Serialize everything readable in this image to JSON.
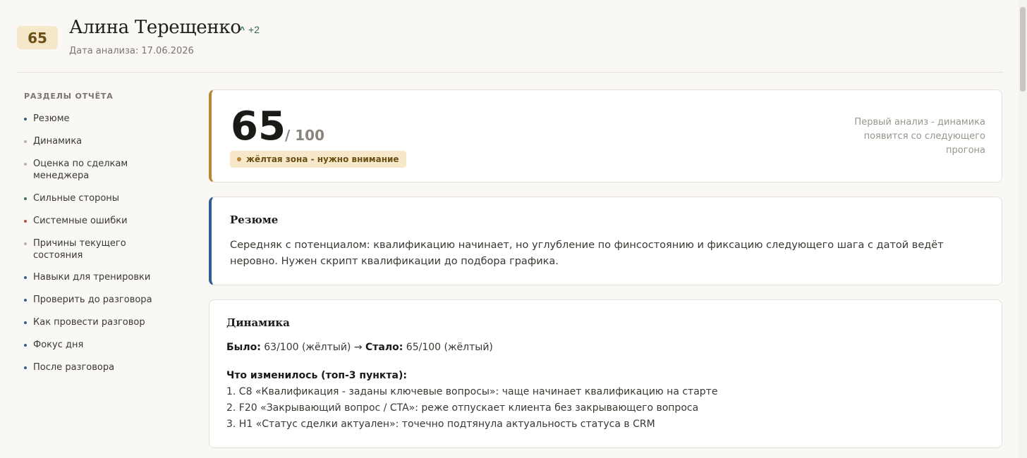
{
  "header": {
    "score_chip": "65",
    "name": "Алина Терещенко",
    "delta_arrow": "^",
    "delta_value": "+2",
    "date": "Дата анализа: 17.06.2026"
  },
  "sidebar": {
    "title": "РАЗДЕЛЫ ОТЧЁТА",
    "items": [
      {
        "label": "Резюме",
        "dot_color": "#2f5d91"
      },
      {
        "label": "Динамика",
        "dot_color": "#b9b4aa"
      },
      {
        "label": "Оценка по сделкам менеджера",
        "dot_color": "#b9b4aa"
      },
      {
        "label": "Сильные стороны",
        "dot_color": "#2f7a52"
      },
      {
        "label": "Системные ошибки",
        "dot_color": "#b5533a"
      },
      {
        "label": "Причины текущего состояния",
        "dot_color": "#b9b4aa"
      },
      {
        "label": "Навыки для тренировки",
        "dot_color": "#2f5d91"
      },
      {
        "label": "Проверить до разговора",
        "dot_color": "#2f5d91"
      },
      {
        "label": "Как провести разговор",
        "dot_color": "#2f5d91"
      },
      {
        "label": "Фокус дня",
        "dot_color": "#2f5d91"
      },
      {
        "label": "После разговора",
        "dot_color": "#2f5d91"
      }
    ]
  },
  "score_card": {
    "score": "65",
    "max": "/ 100",
    "zone": "жёлтая зона - нужно внимание",
    "note": "Первый анализ - динамика появится со следующего прогона"
  },
  "summary": {
    "title": "Резюме",
    "text": "Середняк с потенциалом: квалификацию начинает, но углубление по финсостоянию и фиксацию следующего шага с датой ведёт неровно. Нужен скрипт квалификации до подбора графика."
  },
  "dynamics": {
    "title": "Динамика",
    "was_label": "Было:",
    "was_value": "63/100 (жёлтый) →",
    "now_label": "Стало:",
    "now_value": "65/100 (жёлтый)",
    "changes_title": "Что изменилось (топ-3 пункта):",
    "changes": [
      "1. C8 «Квалификация - заданы ключевые вопросы»: чаще начинает квалификацию на старте",
      "2. F20 «Закрывающий вопрос / CTA»: реже отпускает клиента без закрывающего вопроса",
      "3. H1 «Статус сделки актуален»: точечно подтянула актуальность статуса в CRM"
    ]
  },
  "colors": {
    "accent_gold": "#b88636",
    "accent_blue": "#2f5d91",
    "positive": "#2f6b47"
  }
}
